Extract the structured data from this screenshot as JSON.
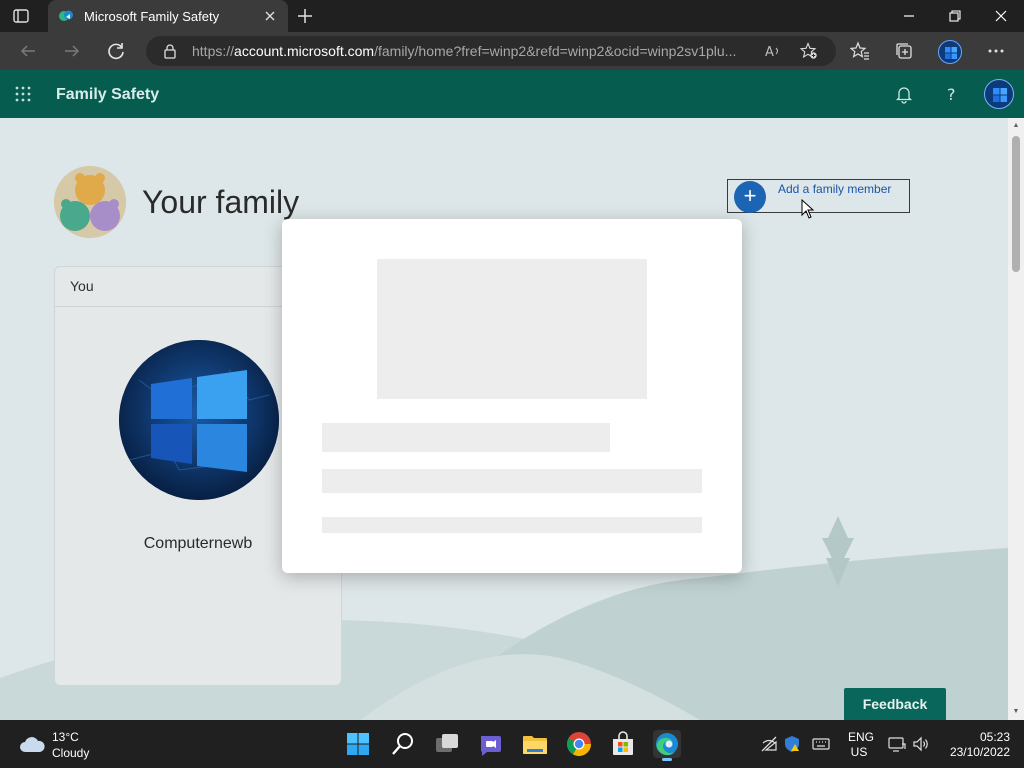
{
  "browser": {
    "tab_title": "Microsoft Family Safety",
    "url_prefix": "https://",
    "url_domain": "account.microsoft.com",
    "url_rest": "/family/home?fref=winp2&refd=winp2&ocid=winp2sv1plu..."
  },
  "app": {
    "name": "Family Safety"
  },
  "page": {
    "title": "Your family",
    "add_member_label": "Add a family member",
    "card_header": "You",
    "member_name": "Computernewb",
    "feedback_label": "Feedback"
  },
  "taskbar": {
    "temperature": "13°C",
    "condition": "Cloudy",
    "lang_line1": "ENG",
    "lang_line2": "US",
    "time": "05:23",
    "date": "23/10/2022"
  }
}
